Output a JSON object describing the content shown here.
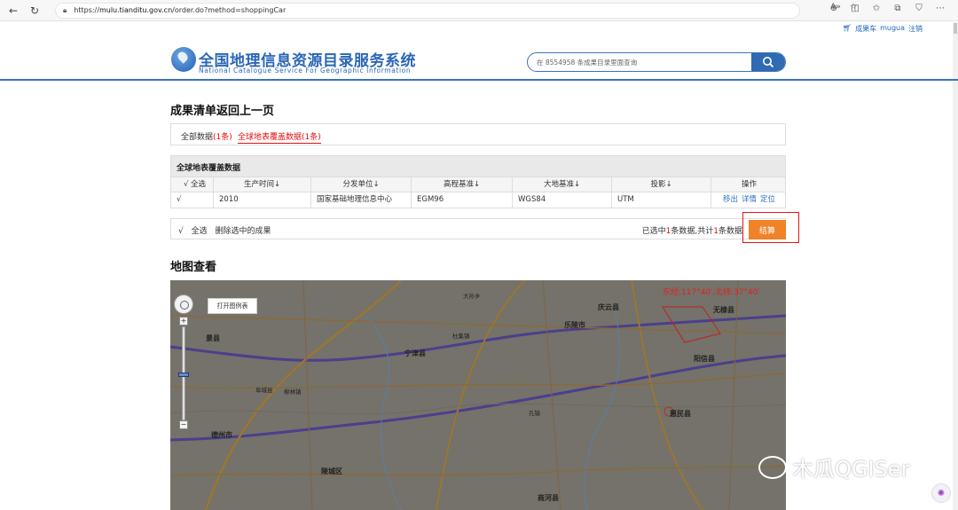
{
  "browser": {
    "url_prefix": "https://",
    "url_host": "mulu.tianditu.gov.cn",
    "url_path": "/order.do?method=shoppingCar",
    "back_icon": "arrow-left-icon",
    "reload_icon": "reload-icon"
  },
  "top_links": {
    "cart": "成果车",
    "user": "mugua",
    "logout": "注销"
  },
  "header": {
    "title": "全国地理信息资源目录服务系统",
    "subtitle": "National Catalogue Service For Geographic Information",
    "search_placeholder": "在 8554958 条成果目录里面查询"
  },
  "page": {
    "title": "成果清单返回上一页"
  },
  "filter_tabs": {
    "all_label": "全部数据",
    "all_count": "(1条)",
    "global_label": "全球地表覆盖数据(1条)"
  },
  "table": {
    "caption": "全球地表覆盖数据",
    "headers": [
      "√  全选",
      "生产时间↓",
      "分发单位↓",
      "高程基准↓",
      "大地基准↓",
      "投影↓",
      "操作"
    ],
    "rows": [
      {
        "check": "√",
        "time": "2010",
        "unit": "国家基础地理信息中心",
        "elevation": "EGM96",
        "datum": "WGS84",
        "projection": "UTM",
        "ops": [
          "移出",
          "详情",
          "定位"
        ]
      }
    ]
  },
  "action_bar": {
    "check": "√",
    "select_all": "全选",
    "delete_selected": "删除选中的成果",
    "summary_prefix": "已选中",
    "summary_num1": "1",
    "summary_mid": "条数据,共计",
    "summary_num2": "1",
    "summary_suffix": "条数据",
    "settle": "结算"
  },
  "map": {
    "title": "地图查看",
    "coords": "东经:117°40′,北纬:37°40′",
    "legend_button": "打开图例表",
    "zoom_plus": "+",
    "zoom_minus": "−",
    "labels": {
      "l1": "庆云县",
      "l2": "无棣县",
      "l3": "乐陵市",
      "l4": "阳信县",
      "l5": "惠民县",
      "l6": "德州市",
      "l7": "陵城区",
      "l8": "宁津县",
      "l9": "商河县",
      "l10": "景县",
      "l11": "阜城县",
      "l12": "大孙乡",
      "l13": "杜集镇",
      "l14": "孔镇",
      "l15": "柳林镇"
    }
  },
  "watermark": "木瓜QGISer"
}
